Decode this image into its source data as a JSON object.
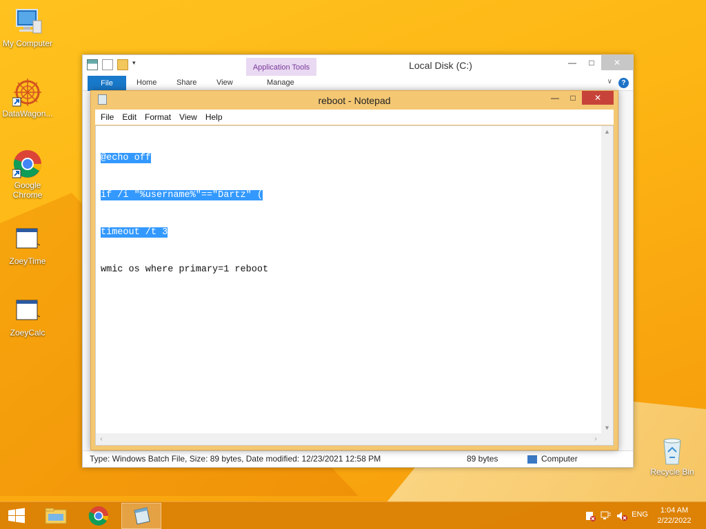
{
  "desktop": {
    "icons": [
      {
        "label": "My Computer",
        "icon": "computer-icon"
      },
      {
        "label": "DataWagon...",
        "icon": "datawagon-icon"
      },
      {
        "label": "Google Chrome",
        "icon": "chrome-icon"
      },
      {
        "label": "ZoeyTime",
        "icon": "window-app-icon"
      },
      {
        "label": "ZoeyCalc",
        "icon": "window-app-icon"
      },
      {
        "label": "Recycle Bin",
        "icon": "recycle-bin-icon"
      }
    ]
  },
  "explorer": {
    "title": "Local Disk (C:)",
    "context_tab_group": "Application Tools",
    "tabs": {
      "file": "File",
      "home": "Home",
      "share": "Share",
      "view": "View",
      "manage": "Manage"
    },
    "status": {
      "details": "Type: Windows Batch File, Size: 89 bytes, Date modified: 12/23/2021 12:58 PM",
      "size": "89 bytes",
      "location": "Computer"
    },
    "controls": {
      "minimize": "—",
      "maximize": "□",
      "close": "✕"
    }
  },
  "notepad": {
    "title": "reboot - Notepad",
    "menu": {
      "file": "File",
      "edit": "Edit",
      "format": "Format",
      "view": "View",
      "help": "Help"
    },
    "lines": [
      {
        "text": "@echo off",
        "selected": true
      },
      {
        "text": "if /i \"%username%\"==\"Dartz\" (",
        "selected": true
      },
      {
        "text": "timeout /t 3",
        "selected": true
      },
      {
        "text": "wmic os where primary=1 reboot",
        "selected": false
      }
    ],
    "controls": {
      "minimize": "—",
      "maximize": "□",
      "close": "✕"
    }
  },
  "taskbar": {
    "language": "ENG",
    "time": "1:04 AM",
    "date": "2/22/2022"
  }
}
